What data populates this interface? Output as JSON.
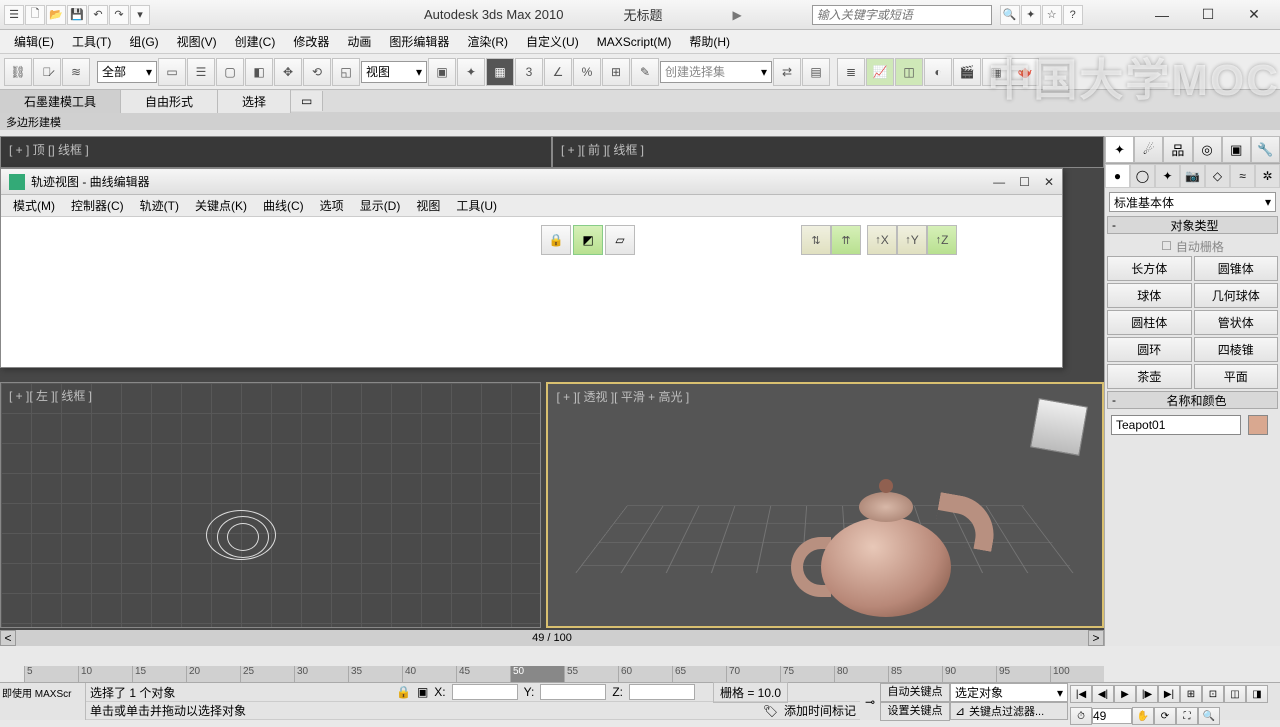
{
  "title_bar": {
    "app_title": "Autodesk 3ds Max  2010",
    "doc_title": "无标题",
    "search_placeholder": "输入关键字或短语"
  },
  "win_controls": {
    "min": "—",
    "max": "☐",
    "close": "✕"
  },
  "menu": [
    "编辑(E)",
    "工具(T)",
    "组(G)",
    "视图(V)",
    "创建(C)",
    "修改器",
    "动画",
    "图形编辑器",
    "渲染(R)",
    "自定义(U)",
    "MAXScript(M)",
    "帮助(H)"
  ],
  "toolbar": {
    "filter_dropdown": "全部",
    "view_dropdown": "视图",
    "selset_dropdown": "创建选择集"
  },
  "ribbon_tabs": [
    "石墨建模工具",
    "自由形式",
    "选择"
  ],
  "ribbon_sub": "多边形建模",
  "viewports": {
    "top": "[ + ] 顶 [] 线框 ]",
    "front": "[ + ][ 前 ][ 线框 ]",
    "left": "[ + ][ 左 ][ 线框 ]",
    "persp": "[ + ][ 透视 ][ 平滑 + 高光 ]"
  },
  "dialog": {
    "title": "轨迹视图 - 曲线编辑器",
    "menu": [
      "模式(M)",
      "控制器(C)",
      "轨迹(T)",
      "关键点(K)",
      "曲线(C)",
      "选项",
      "显示(D)",
      "视图",
      "工具(U)"
    ],
    "axes": [
      "X",
      "Y",
      "Z"
    ]
  },
  "right_panel": {
    "dropdown": "标准基本体",
    "rollout_type": "对象类型",
    "autogrid": "自动栅格",
    "buttons": [
      [
        "长方体",
        "圆锥体"
      ],
      [
        "球体",
        "几何球体"
      ],
      [
        "圆柱体",
        "管状体"
      ],
      [
        "圆环",
        "四棱锥"
      ],
      [
        "茶壶",
        "平面"
      ]
    ],
    "rollout_name": "名称和颜色",
    "object_name": "Teapot01"
  },
  "time_slider": {
    "label": "49 / 100"
  },
  "ruler": [
    5,
    10,
    15,
    20,
    25,
    30,
    35,
    40,
    45,
    50,
    55,
    60,
    65,
    70,
    75,
    80,
    85,
    90,
    95,
    100
  ],
  "scroll": {
    "left": "<",
    "right": ">"
  },
  "status": {
    "left": "即使用 MAXScr",
    "selection": "选择了 1 个对象",
    "hint": "单击或单击并拖动以选择对象",
    "x": "X:",
    "y": "Y:",
    "z": "Z:",
    "grid": "栅格 = 10.0",
    "add_marker": "添加时间标记",
    "autokey": "自动关键点",
    "setkey": "设置关键点",
    "sel_obj": "选定对象",
    "key_filter": "关键点过滤器...",
    "frame_val": "49"
  },
  "playback": [
    "|◀",
    "◀|",
    "▶",
    "|▶",
    "▶|"
  ],
  "watermark": "中国大学MOC"
}
